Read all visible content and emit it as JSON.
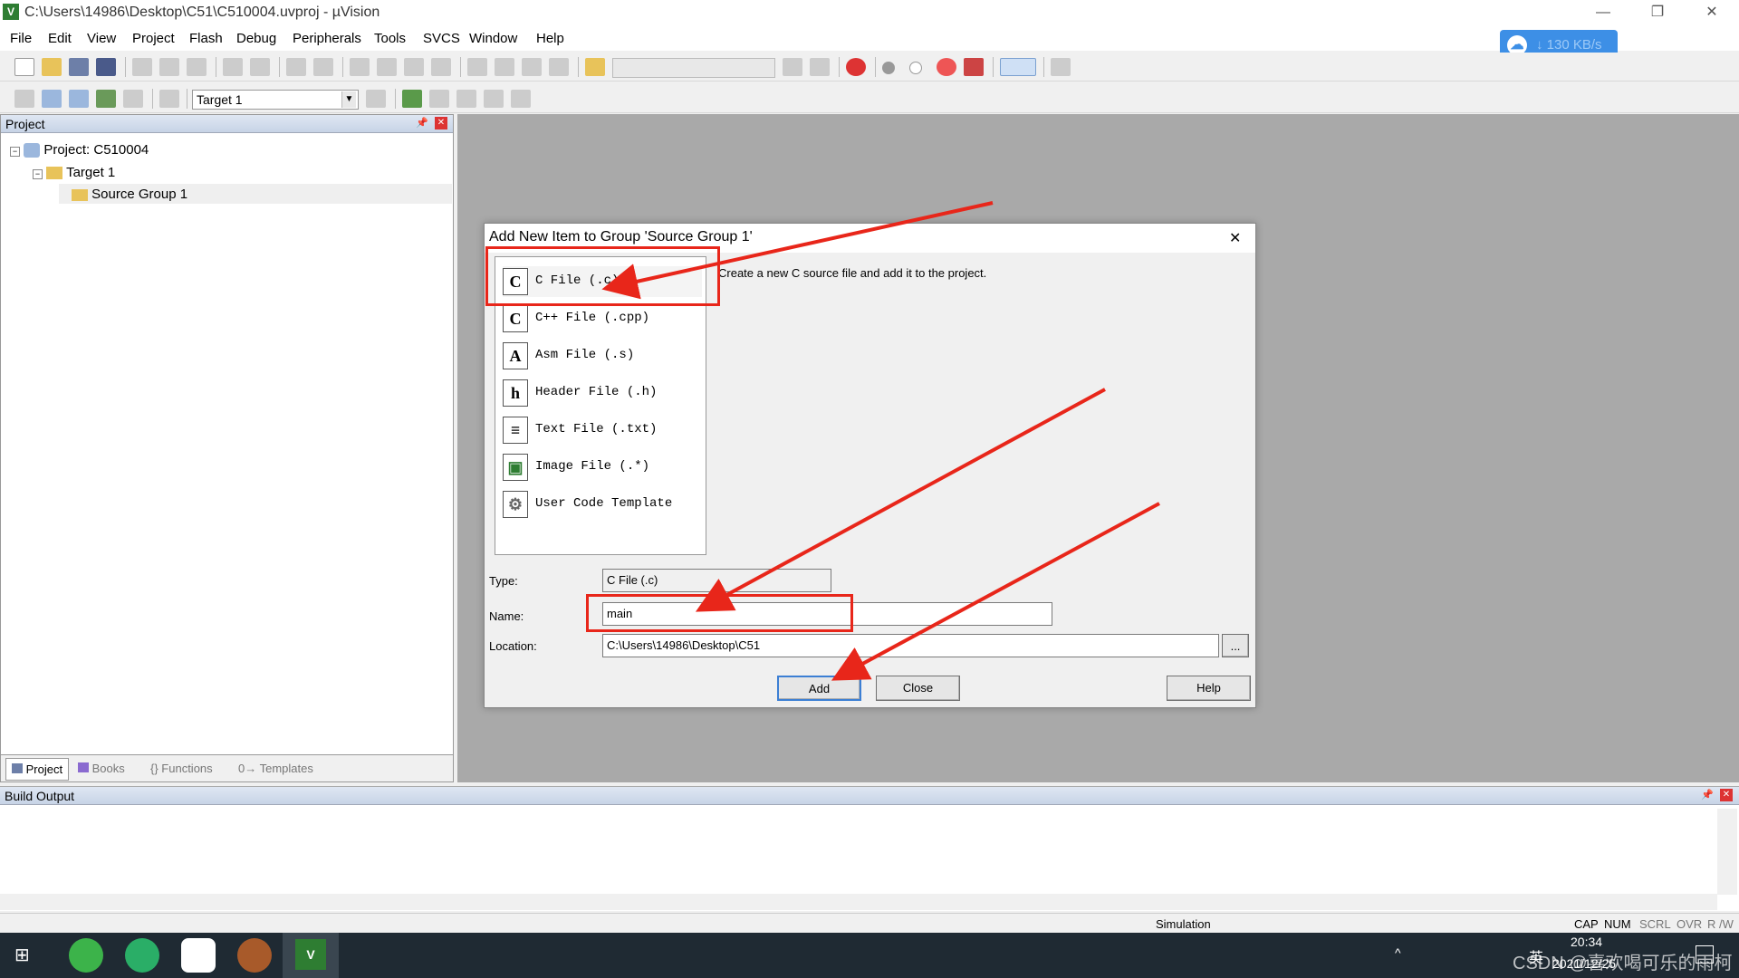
{
  "window": {
    "title": "C:\\Users\\14986\\Desktop\\C51\\C510004.uvproj - µVision",
    "icon": "uvision-icon"
  },
  "menu": [
    "File",
    "Edit",
    "View",
    "Project",
    "Flash",
    "Debug",
    "Peripherals",
    "Tools",
    "SVCS",
    "Window",
    "Help"
  ],
  "speed_widget": {
    "text": "130 KB/s",
    "arrow": "↓"
  },
  "toolbar2": {
    "target": "Target 1"
  },
  "project_panel": {
    "title": "Project",
    "root": "Project: C510004",
    "target": "Target 1",
    "group": "Source Group 1"
  },
  "panel_tabs": [
    "Project",
    "Books",
    "{} Functions",
    "0→ Templates"
  ],
  "dialog": {
    "title": "Add New Item to Group 'Source Group 1'",
    "description": "Create a new C source file and add it to the project.",
    "items": [
      {
        "icon": "C",
        "label": "C File (.c)"
      },
      {
        "icon": "C",
        "label": "C++ File (.cpp)"
      },
      {
        "icon": "A",
        "label": "Asm File (.s)"
      },
      {
        "icon": "h",
        "label": "Header File (.h)"
      },
      {
        "icon": "≡",
        "label": "Text File (.txt)"
      },
      {
        "icon": "▣",
        "label": "Image File (.*)"
      },
      {
        "icon": "⚙",
        "label": "User Code Template"
      }
    ],
    "type_label": "Type:",
    "type_value": "C File (.c)",
    "name_label": "Name:",
    "name_value": "main",
    "location_label": "Location:",
    "location_value": "C:\\Users\\14986\\Desktop\\C51",
    "browse": "...",
    "add": "Add",
    "close": "Close",
    "help": "Help"
  },
  "build_output": {
    "title": "Build Output"
  },
  "status": {
    "mode": "Simulation",
    "indicators": [
      "CAP",
      "NUM",
      "SCRL",
      "OVR",
      "R /W"
    ]
  },
  "taskbar": {
    "time": "20:34",
    "date": "2021/12/25",
    "ime": "英",
    "watermark": "CSDN @喜欢喝可乐的雨柯"
  },
  "colors": {
    "annotation": "#e8261a",
    "accent": "#3d8fe6"
  }
}
